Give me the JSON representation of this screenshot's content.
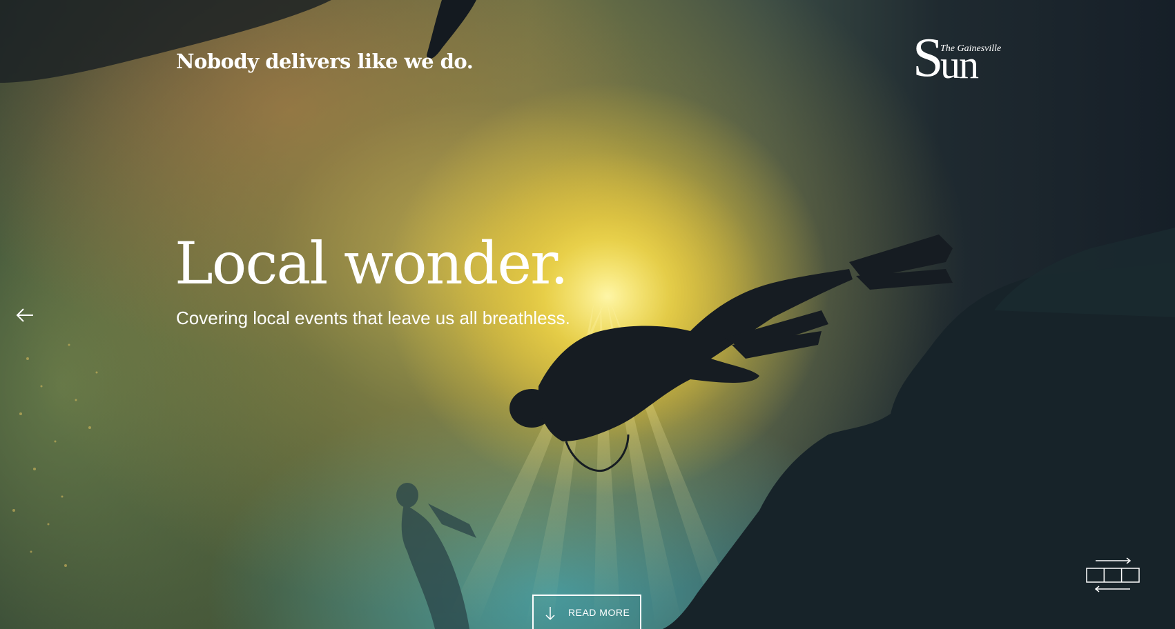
{
  "header": {
    "tagline": "Nobody delivers like we do.",
    "logo": {
      "top_text": "The Gainesville",
      "main_text": "Sun"
    }
  },
  "hero": {
    "headline": "Local wonder.",
    "subheadline": "Covering local events that leave us all breathless.",
    "read_more_label": "READ MORE",
    "image": "scuba-divers-underwater-sunlight"
  },
  "controls": {
    "prev_icon": "arrow-left-icon",
    "view_toggle_icon": "slider-toggle-icon",
    "read_more_icon": "arrow-down-icon"
  },
  "colors": {
    "text": "#ffffff",
    "background_dark": "#16202a",
    "glow": "#e6c83c"
  }
}
